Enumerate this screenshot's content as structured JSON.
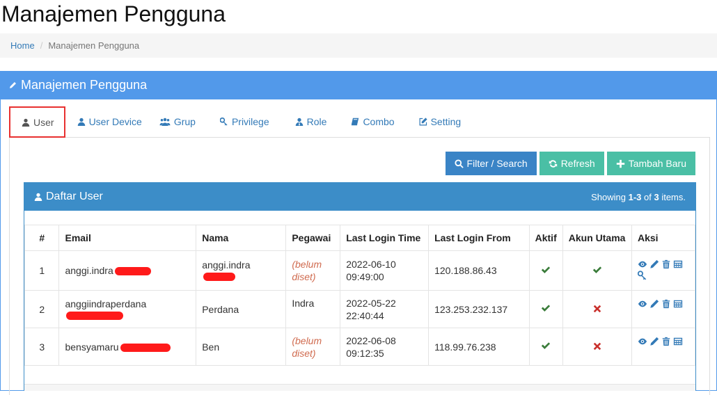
{
  "page": {
    "title": "Manajemen Pengguna"
  },
  "breadcrumb": {
    "home": "Home",
    "separator": "/",
    "current": "Manajemen Pengguna"
  },
  "panel": {
    "title": "Manajemen Pengguna"
  },
  "tabs": [
    {
      "label": "User",
      "icon": "user-icon",
      "active": true
    },
    {
      "label": "User Device",
      "icon": "user-icon"
    },
    {
      "label": "Grup",
      "icon": "users-icon"
    },
    {
      "label": "Privilege",
      "icon": "key-icon"
    },
    {
      "label": "Role",
      "icon": "user-tie-icon"
    },
    {
      "label": "Combo",
      "icon": "book-icon"
    },
    {
      "label": "Setting",
      "icon": "edit-icon"
    }
  ],
  "toolbar": {
    "filter_label": "Filter / Search",
    "refresh_label": "Refresh",
    "add_label": "Tambah Baru"
  },
  "list": {
    "title": "Daftar User",
    "summary": {
      "prefix": "Showing ",
      "range": "1-3",
      "mid": " of ",
      "total": "3",
      "suffix": " items."
    },
    "columns": [
      "#",
      "Email",
      "Nama",
      "Pegawai",
      "Last Login Time",
      "Last Login From",
      "Aktif",
      "Akun Utama",
      "Aksi"
    ],
    "rows": [
      {
        "no": "1",
        "email": "anggi.indra",
        "nama": "anggi.indra",
        "pegawai": "(belum diset)",
        "pegawai_set": false,
        "login_time": "2022-06-10 09:49:00",
        "login_from": "120.188.86.43",
        "aktif": true,
        "akun_utama": true
      },
      {
        "no": "2",
        "email": "anggiindraperdana",
        "nama": "Perdana",
        "pegawai": "Indra",
        "pegawai_set": true,
        "login_time": "2022-05-22 22:40:44",
        "login_from": "123.253.232.137",
        "aktif": true,
        "akun_utama": false
      },
      {
        "no": "3",
        "email": "bensyamaru",
        "nama": "Ben",
        "pegawai": "(belum diset)",
        "pegawai_set": false,
        "login_time": "2022-06-08 09:12:35",
        "login_from": "118.99.76.238",
        "aktif": true,
        "akun_utama": false
      }
    ]
  },
  "colors": {
    "primary": "#5299ea",
    "list_header": "#3c8dc8",
    "teal": "#4abfa5",
    "check": "#3a7c3a",
    "cross": "#c9302c",
    "active_tab_border": "#e8302f"
  }
}
